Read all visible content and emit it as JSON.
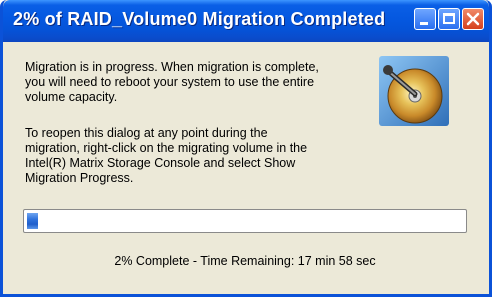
{
  "window": {
    "title": "2% of RAID_Volume0 Migration Completed"
  },
  "titlebar_buttons": {
    "minimize": "minimize-icon",
    "maximize": "maximize-icon",
    "close": "close-icon"
  },
  "message": {
    "line1": "Migration is in progress. When migration is complete,",
    "line2": "you will need to reboot your system to use the entire",
    "line3": "volume capacity.",
    "line4": "To reopen this dialog at any point during the",
    "line5": "migration, right-click on the migrating volume in the",
    "line6": "Intel(R) Matrix Storage Console and select Show",
    "line7": "Migration Progress."
  },
  "icon": "hard-disk-icon",
  "progress": {
    "percent": 2
  },
  "status": {
    "text": "2% Complete - Time Remaining: 17 min 58 sec"
  },
  "colors": {
    "titlebar": "#0558e0",
    "close_button": "#d6401c",
    "progress_fill": "#2f72dc",
    "dialog_background": "#ece9d8"
  }
}
